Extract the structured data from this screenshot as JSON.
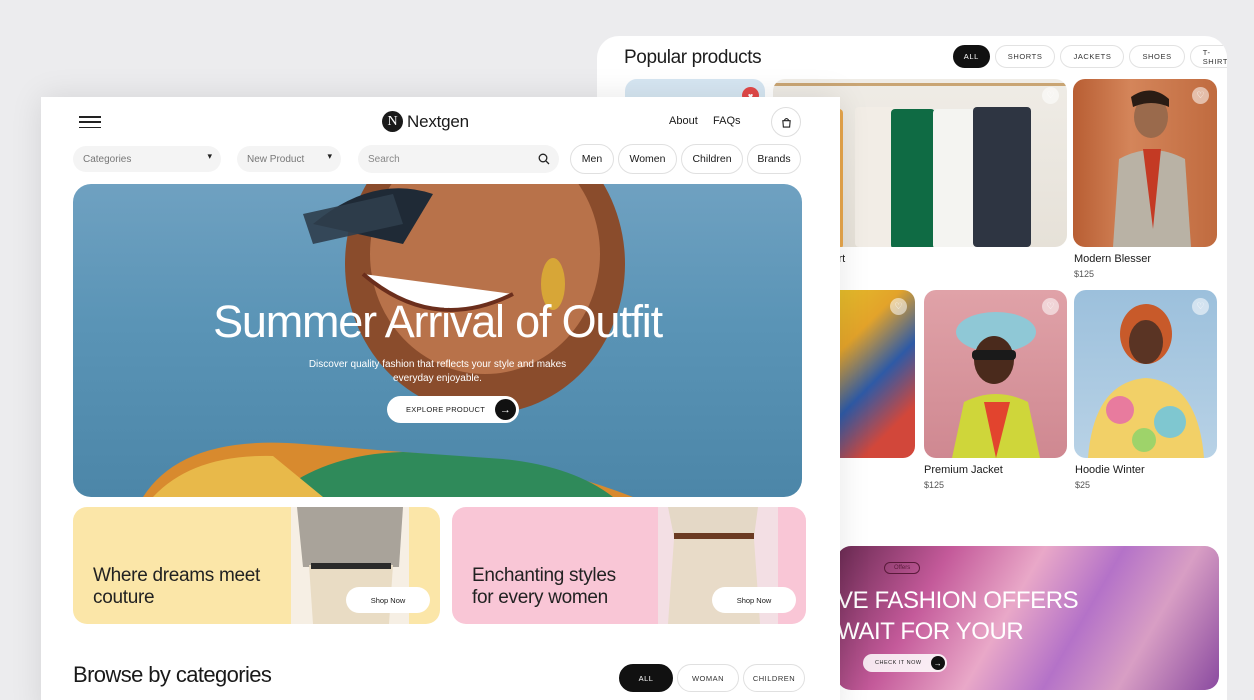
{
  "popular": {
    "title": "Popular products",
    "filters": [
      "ALL",
      "SHORTS",
      "JACKETS",
      "SHOES",
      "T-SHIRT"
    ],
    "products": [
      {
        "name": "Modern Blesser",
        "price": "$125"
      },
      {
        "name": "Premium Jacket",
        "price": "$125"
      },
      {
        "name": "Hoodie Winter",
        "price": "$25"
      }
    ],
    "partial_label": "irt"
  },
  "offer": {
    "tag": "Offers",
    "line1": "VE FASHION OFFERS",
    "line2": "WAIT FOR YOUR",
    "button": "CHECK IT NOW"
  },
  "header": {
    "logo_letter": "N",
    "logo_text": "Nextgen",
    "nav": [
      "About",
      "FAQs"
    ],
    "bag_icon": "shopping-bag-icon",
    "menu_icon": "hamburger-menu-icon"
  },
  "filters": {
    "categories": "Categories",
    "new_product": "New Product",
    "search_placeholder": "Search",
    "tabs": [
      "Men",
      "Women",
      "Children",
      "Brands"
    ]
  },
  "hero": {
    "title": "Summer Arrival of Outfit",
    "subtitle_1": "Discover quality fashion that reflects your style and makes",
    "subtitle_2": "everyday enjoyable.",
    "button": "EXPLORE PRODUCT"
  },
  "promos": [
    {
      "line1": "Where dreams meet",
      "line2": "couture",
      "button": "Shop Now",
      "bg": "#fbe6a8"
    },
    {
      "line1": "Enchanting styles",
      "line2": "for every women",
      "button": "Shop Now",
      "bg": "#f9c6d6"
    }
  ],
  "browse": {
    "title": "Browse by categories",
    "tabs": [
      "ALL",
      "WOMAN",
      "CHILDREN"
    ]
  },
  "colors": {
    "accent": "#111111",
    "heart_active": "#e24848",
    "hero_sky": "#5a94b6"
  }
}
